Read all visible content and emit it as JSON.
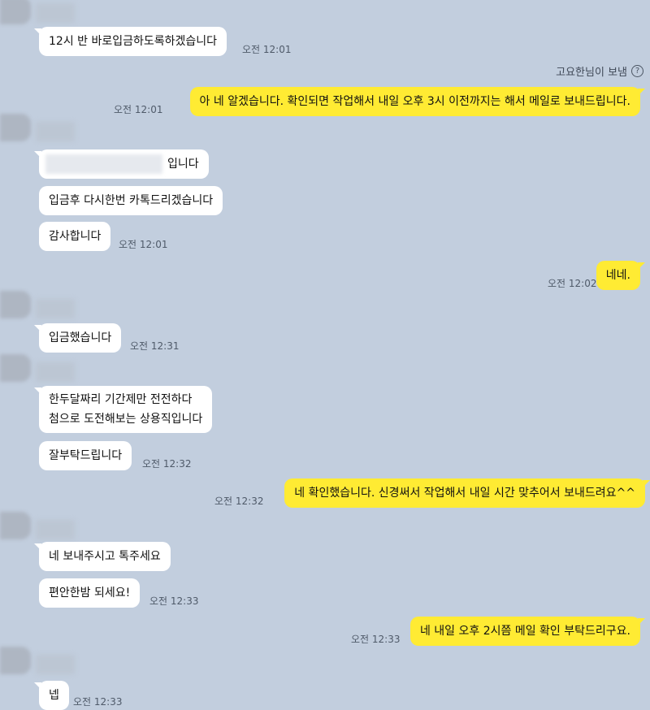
{
  "messages": {
    "m1": {
      "text": "12시 반 바로입금하도록하겠습니다",
      "time": "오전 12:01"
    },
    "sender_note": {
      "text": "고요한님이 보냄",
      "icon": "help-circle-icon"
    },
    "m2": {
      "text": "아 네 알겠습니다. 확인되면 작업해서 내일 오후 3시 이전까지는 해서 메일로 보내드립니다.",
      "time": "오전 12:01"
    },
    "m3": {
      "text": "입니다"
    },
    "m4": {
      "text": "입금후 다시한번 카톡드리겠습니다"
    },
    "m5": {
      "text": "감사합니다",
      "time": "오전 12:01"
    },
    "m6": {
      "text": "네네.",
      "time": "오전 12:02"
    },
    "m7": {
      "text": "입금했습니다",
      "time": "오전 12:31"
    },
    "m8": {
      "line1": "한두달짜리 기간제만 전전하다",
      "line2": "첨으로 도전해보는 상용직입니다"
    },
    "m9": {
      "text": "잘부탁드립니다",
      "time": "오전 12:32"
    },
    "m10": {
      "text": "네 확인했습니다. 신경써서 작업해서 내일 시간 맞추어서 보내드려요^^",
      "time": "오전 12:32"
    },
    "m11": {
      "text": "네 보내주시고 톡주세요"
    },
    "m12": {
      "text": "편안한밤 되세요!",
      "time": "오전 12:33"
    },
    "m13": {
      "text": "네 내일 오후 2시쯤 메일 확인 부탁드리구요.",
      "time": "오전 12:33"
    },
    "m14": {
      "text": "넵",
      "time": "오전 12:33"
    }
  },
  "colors": {
    "background": "#c2cede",
    "incoming": "#ffffff",
    "outgoing": "#ffeb33"
  }
}
